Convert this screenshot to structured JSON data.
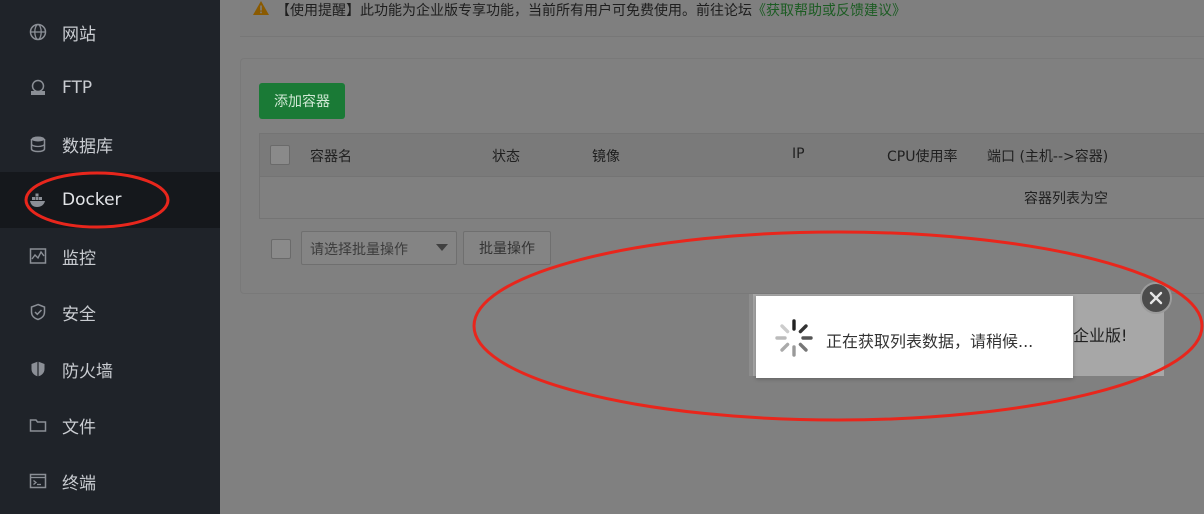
{
  "sidebar": {
    "items": [
      {
        "label": "网站",
        "icon": "globe-icon"
      },
      {
        "label": "FTP",
        "icon": "ftp-icon"
      },
      {
        "label": "数据库",
        "icon": "database-icon"
      },
      {
        "label": "Docker",
        "icon": "docker-icon",
        "active": true
      },
      {
        "label": "监控",
        "icon": "monitor-icon"
      },
      {
        "label": "安全",
        "icon": "shield-icon"
      },
      {
        "label": "防火墙",
        "icon": "firewall-icon"
      },
      {
        "label": "文件",
        "icon": "folder-icon"
      },
      {
        "label": "终端",
        "icon": "terminal-icon"
      }
    ]
  },
  "notice": {
    "text": "【使用提醒】此功能为企业版专享功能，当前所有用户可免费使用。前往论坛",
    "link": "《获取帮助或反馈建议》",
    "icon": "warning-icon"
  },
  "panel": {
    "add_button": "添加容器",
    "columns": [
      "容器名",
      "状态",
      "镜像",
      "IP",
      "CPU使用率",
      "端口 (主机-->容器)"
    ],
    "empty_text": "容器列表为空",
    "batch_placeholder": "请选择批量操作",
    "batch_button": "批量操作"
  },
  "dialog": {
    "background_text": "企业版!",
    "loading_text": "正在获取列表数据，请稍候..."
  },
  "colors": {
    "sidebar_bg": "#1f2329",
    "accent_green": "#1a7a36",
    "annotation_red": "#e8261c"
  }
}
